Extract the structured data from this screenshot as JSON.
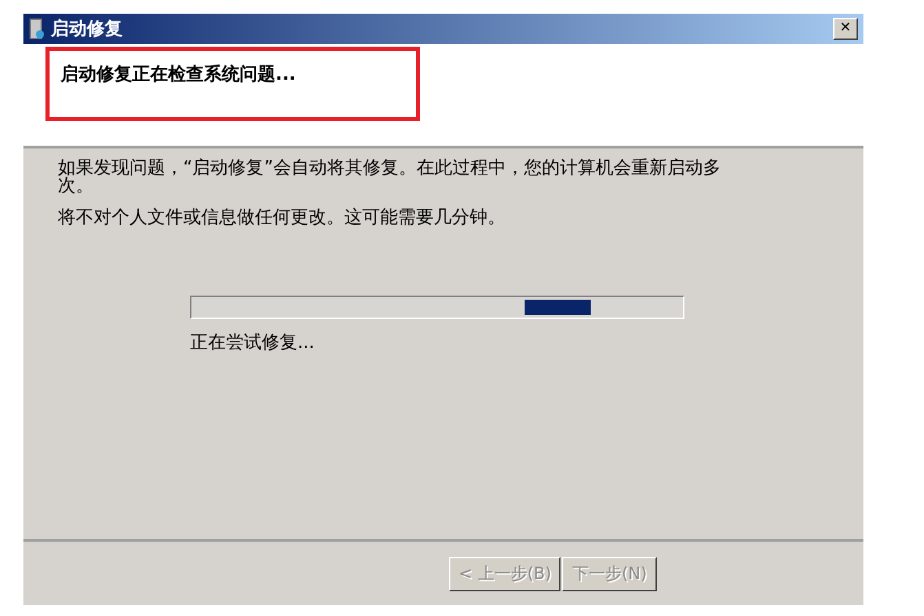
{
  "window": {
    "title": "启动修复",
    "close": "✕"
  },
  "header": {
    "heading": "启动修复正在检查系统问题...",
    "highlighted": true
  },
  "body": {
    "paragraphs": [
      "如果发现问题，“启动修复”会自动将其修复。在此过程中，您的计算机会重新启动多次。",
      "将不对个人文件或信息做任何更改。这可能需要几分钟。"
    ],
    "progress": {
      "status": "正在尝试修复..."
    }
  },
  "buttons": [
    {
      "label": "< 上一步(B)",
      "disabled": true
    },
    {
      "label": "下一步(N)",
      "disabled": true
    }
  ]
}
